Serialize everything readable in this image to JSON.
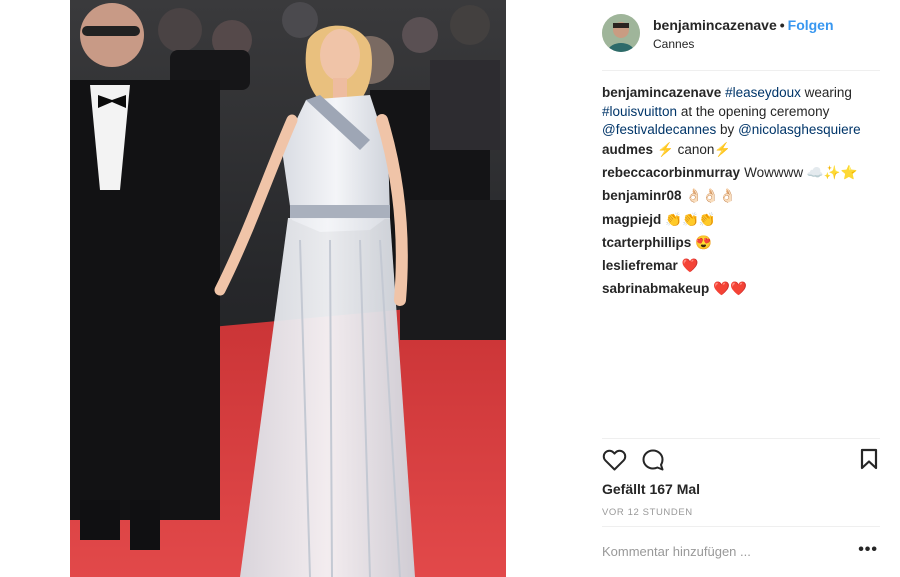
{
  "post": {
    "image_icon": "photo-red-carpet",
    "header": {
      "username": "benjamincazenave",
      "dot": "•",
      "follow_label": "Folgen",
      "location": "Cannes",
      "avatar_icon": "user-avatar"
    },
    "caption": {
      "username": "benjamincazenave",
      "hashtag1": "#leaseydoux",
      "text1": "wearing",
      "hashtag2": "#louisvuitton",
      "text2": "at the opening ceremony",
      "mention1": "@festivaldecannes",
      "text3": "by",
      "mention2": "@nicolasghesquiere"
    },
    "comments": [
      {
        "user": "audmes",
        "text": "⚡ canon⚡"
      },
      {
        "user": "rebeccacorbinmurray",
        "text": "Wowwww ☁️✨⭐"
      },
      {
        "user": "benjaminr08",
        "text": "👌🏻👌🏻👌🏻"
      },
      {
        "user": "magpiejd",
        "text": "👏👏👏"
      },
      {
        "user": "tcarterphillips",
        "text": "😍"
      },
      {
        "user": "lesliefremar",
        "text": "❤️"
      },
      {
        "user": "sabrinabmakeup",
        "text": "❤️❤️"
      }
    ],
    "actions": {
      "like_icon": "heart-outline-icon",
      "comment_icon": "speech-bubble-icon",
      "save_icon": "bookmark-icon"
    },
    "likes_text": "Gefällt 167 Mal",
    "timestamp": "VOR 12 STUNDEN",
    "add_comment_placeholder": "Kommentar hinzufügen ...",
    "more_label": "•••",
    "colors": {
      "link": "#003569",
      "follow": "#3897f0",
      "muted": "#999999",
      "carpet": "#d93b3c"
    }
  }
}
